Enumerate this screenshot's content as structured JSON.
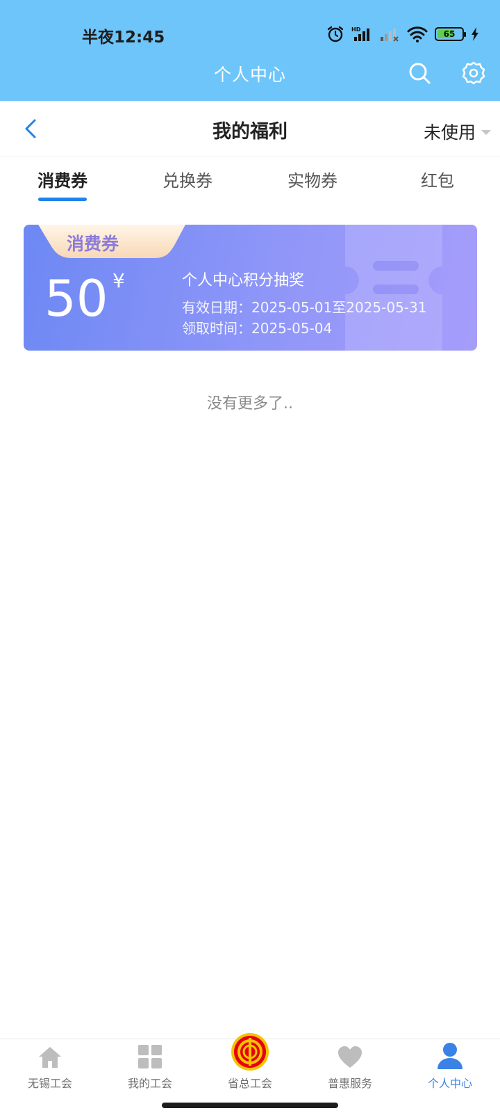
{
  "status_bar": {
    "time": "半夜12:45",
    "battery": "65"
  },
  "app_header": {
    "title": "个人中心"
  },
  "sub_header": {
    "title": "我的福利",
    "filter": "未使用"
  },
  "tabs": [
    {
      "label": "消费券",
      "active": true
    },
    {
      "label": "兑换券",
      "active": false
    },
    {
      "label": "实物券",
      "active": false
    },
    {
      "label": "红包",
      "active": false
    }
  ],
  "coupon": {
    "tag": "消费券",
    "amount": "50",
    "currency": "¥",
    "name": "个人中心积分抽奖",
    "valid": "有效日期：2025-05-01至2025-05-31",
    "received": "领取时间：2025-05-04"
  },
  "no_more": "没有更多了..",
  "bottom_nav": [
    {
      "label": "无锡工会",
      "icon": "home-icon"
    },
    {
      "label": "我的工会",
      "icon": "grid-icon"
    },
    {
      "label": "省总工会",
      "icon": "union-logo-icon"
    },
    {
      "label": "普惠服务",
      "icon": "heart-icon"
    },
    {
      "label": "个人中心",
      "icon": "person-icon",
      "active": true
    }
  ],
  "colors": {
    "header_blue": "#6ec5fa",
    "accent_blue": "#1f83ea",
    "card_start": "#6d88f4",
    "card_end": "#a69dfa"
  }
}
